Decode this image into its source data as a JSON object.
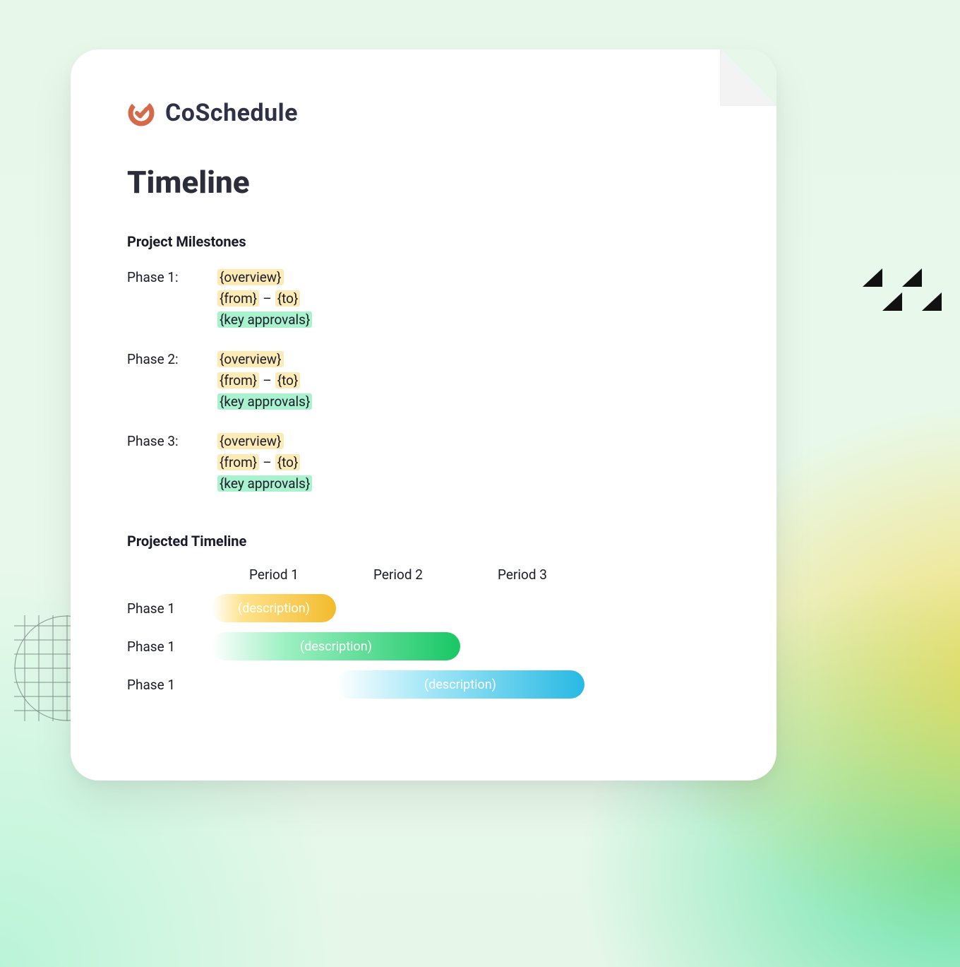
{
  "brand": {
    "name": "CoSchedule"
  },
  "title": "Timeline",
  "sections": {
    "milestones": "Project Milestones",
    "projected": "Projected Timeline"
  },
  "milestones": {
    "phases": [
      {
        "label": "Phase 1:",
        "overview": "{overview}",
        "from": "{from}",
        "to": "{to}",
        "approvals": "{key approvals}",
        "dash": "–"
      },
      {
        "label": "Phase 2:",
        "overview": "{overview}",
        "from": "{from}",
        "to": "{to}",
        "approvals": "{key approvals}",
        "dash": "–"
      },
      {
        "label": "Phase 3:",
        "overview": "{overview}",
        "from": "{from}",
        "to": "{to}",
        "approvals": "{key approvals}",
        "dash": "–"
      }
    ]
  },
  "projected": {
    "periods": [
      "Period 1",
      "Period 2",
      "Period 3"
    ],
    "rows": [
      {
        "label": "Phase 1",
        "desc": "(description)"
      },
      {
        "label": "Phase 1",
        "desc": "(description)"
      },
      {
        "label": "Phase 1",
        "desc": "(description)"
      }
    ]
  },
  "chart_data": {
    "type": "bar",
    "title": "Projected Timeline",
    "categories": [
      "Period 1",
      "Period 2",
      "Period 3"
    ],
    "xlabel": "",
    "ylabel": "",
    "series": [
      {
        "name": "Phase 1",
        "start": 0,
        "end": 1.0,
        "desc": "(description)",
        "color": "#f2bb2d"
      },
      {
        "name": "Phase 1",
        "start": 0,
        "end": 2.0,
        "desc": "(description)",
        "color": "#19c765"
      },
      {
        "name": "Phase 1",
        "start": 1.0,
        "end": 3.0,
        "desc": "(description)",
        "color": "#28b9e3"
      }
    ]
  }
}
